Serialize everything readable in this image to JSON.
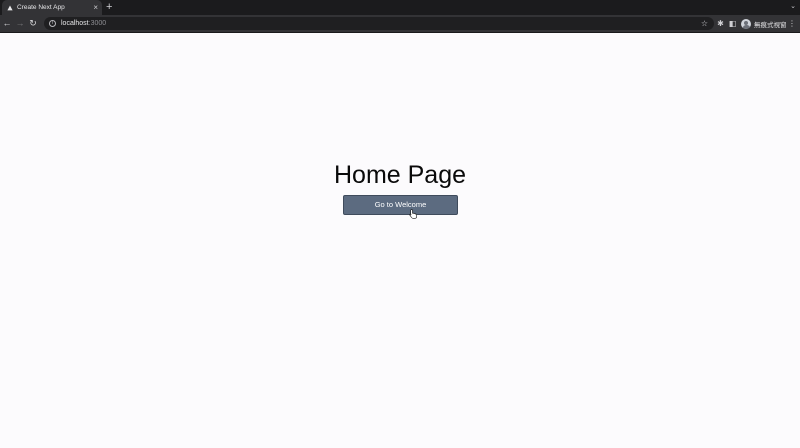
{
  "browser": {
    "tab": {
      "title": "Create Next App",
      "favicon": "triangle-icon",
      "close_glyph": "×"
    },
    "new_tab_glyph": "+",
    "tabstrip_menu_glyph": "⌄",
    "toolbar": {
      "back_glyph": "←",
      "forward_glyph": "→",
      "reload_glyph": "↻",
      "info_glyph": "i",
      "url_host": "localhost",
      "url_port": ":3000",
      "bookmark_glyph": "☆",
      "extensions_glyph": "✱",
      "sidepanel_glyph": "◧",
      "profile_label": "無痕式視窗",
      "menu_glyph": "⋮"
    }
  },
  "page": {
    "title": "Home Page",
    "button_label": "Go to Welcome"
  },
  "colors": {
    "page_background": "#fcfbfd",
    "button_background": "#5c6b80",
    "toolbar_background": "#333336",
    "tabstrip_background": "#1b1b1d"
  }
}
